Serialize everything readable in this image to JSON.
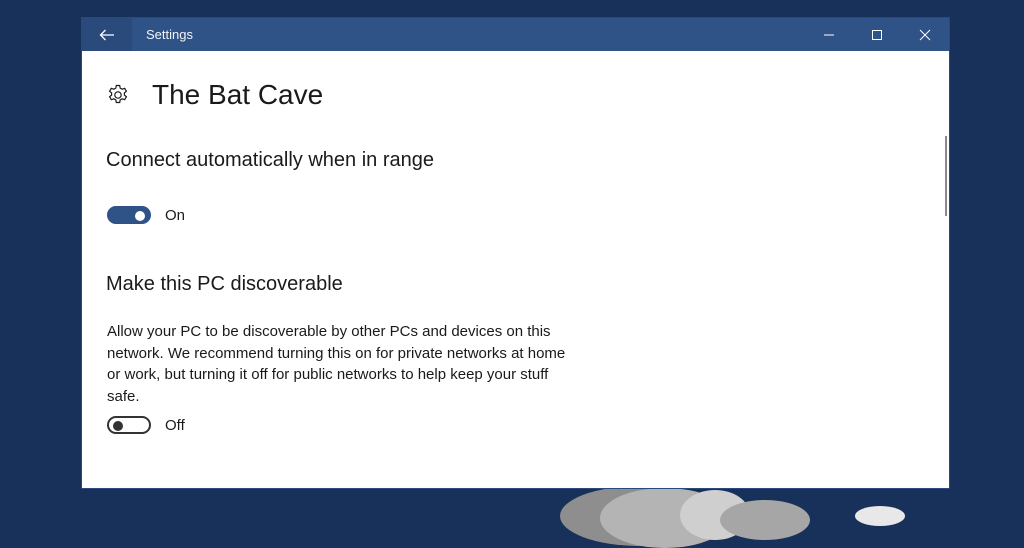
{
  "window": {
    "title": "Settings",
    "back_icon": "arrow-left-icon",
    "controls": {
      "minimize_icon": "minimize-icon",
      "maximize_icon": "maximize-icon",
      "close_icon": "close-icon"
    }
  },
  "page": {
    "icon": "gear-icon",
    "title": "The Bat Cave"
  },
  "sections": [
    {
      "heading": "Connect automatically when in range",
      "toggle": {
        "state": "on",
        "label": "On"
      }
    },
    {
      "heading": "Make this PC discoverable",
      "description": "Allow your PC to be discoverable by other PCs and devices on this network. We recommend turning this on for private networks at home or work, but turning it off for public networks to help keep your stuff safe.",
      "toggle": {
        "state": "off",
        "label": "Off"
      }
    }
  ],
  "colors": {
    "titlebar": "#2f5287",
    "accent": "#2f5287",
    "desktop": "#17315a"
  }
}
